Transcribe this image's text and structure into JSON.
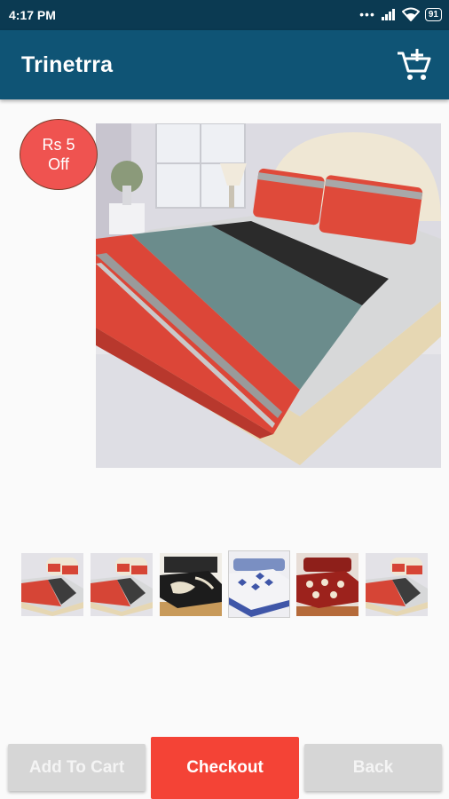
{
  "status_bar": {
    "time": "4:17 PM",
    "battery": "91"
  },
  "app_bar": {
    "title": "Trinetrra",
    "cart_icon": "add-shopping-cart-icon"
  },
  "product": {
    "discount_line1": "Rs 5",
    "discount_line2": "Off",
    "main_image": "bedsheet-red-grey-black"
  },
  "thumbnails": [
    {
      "name": "bedsheet-red-grey"
    },
    {
      "name": "bedsheet-red-grey"
    },
    {
      "name": "bedsheet-black-white"
    },
    {
      "name": "bedsheet-white-blue"
    },
    {
      "name": "bedsheet-maroon-floral"
    },
    {
      "name": "bedsheet-red-grey"
    }
  ],
  "actions": {
    "add_to_cart": "Add To Cart",
    "checkout": "Checkout",
    "back": "Back"
  },
  "colors": {
    "status_bar": "#0b3a52",
    "app_bar": "#0f5475",
    "accent_red": "#f44336",
    "badge": "#ef5350"
  }
}
